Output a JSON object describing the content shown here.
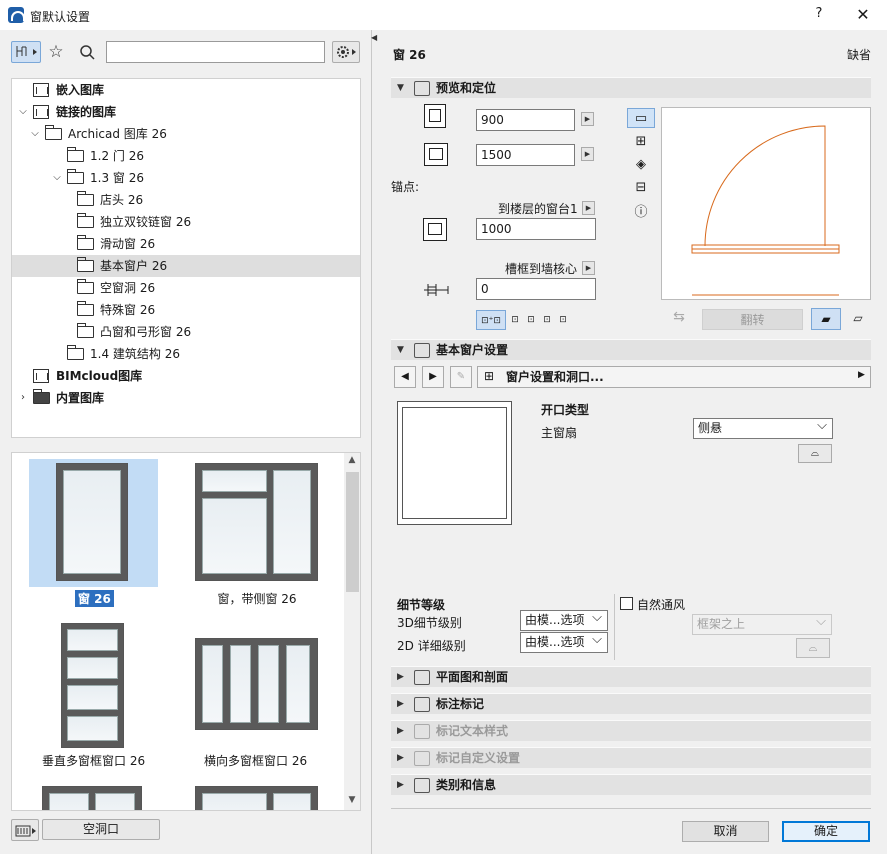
{
  "window": {
    "title": "窗默认设置",
    "help": "?",
    "close": "✕"
  },
  "left": {
    "search_value": "",
    "tree": [
      {
        "label": "嵌入图库",
        "bold": true,
        "indent": 0,
        "chevron": "",
        "icon": "library"
      },
      {
        "label": "链接的图库",
        "bold": true,
        "indent": 0,
        "chevron": "⌵",
        "icon": "library"
      },
      {
        "label": "Archicad 图库 26",
        "bold": false,
        "indent": 1,
        "chevron": "⌵",
        "icon": "folder"
      },
      {
        "label": "1.2 门 26",
        "bold": false,
        "indent": 2,
        "chevron": "",
        "icon": "folder"
      },
      {
        "label": "1.3 窗 26",
        "bold": false,
        "indent": 2,
        "chevron": "⌵",
        "icon": "folder"
      },
      {
        "label": "店头 26",
        "bold": false,
        "indent": 3,
        "chevron": "",
        "icon": "folder"
      },
      {
        "label": "独立双铰链窗 26",
        "bold": false,
        "indent": 3,
        "chevron": "",
        "icon": "folder"
      },
      {
        "label": "滑动窗 26",
        "bold": false,
        "indent": 3,
        "chevron": "",
        "icon": "folder"
      },
      {
        "label": "基本窗户 26",
        "bold": false,
        "indent": 3,
        "chevron": "",
        "icon": "folder",
        "selected": true
      },
      {
        "label": "空窗洞 26",
        "bold": false,
        "indent": 3,
        "chevron": "",
        "icon": "folder"
      },
      {
        "label": "特殊窗 26",
        "bold": false,
        "indent": 3,
        "chevron": "",
        "icon": "folder"
      },
      {
        "label": "凸窗和弓形窗 26",
        "bold": false,
        "indent": 3,
        "chevron": "",
        "icon": "folder"
      },
      {
        "label": "1.4 建筑结构 26",
        "bold": false,
        "indent": 2,
        "chevron": "",
        "icon": "folder"
      },
      {
        "label": "BIMcloud图库",
        "bold": true,
        "indent": 0,
        "chevron": "",
        "icon": "library"
      },
      {
        "label": "内置图库",
        "bold": true,
        "indent": 0,
        "chevron": "›",
        "icon": "folder-dark"
      }
    ],
    "thumbnails": [
      {
        "label": "窗 26",
        "selected": true
      },
      {
        "label": "窗，带侧窗 26",
        "selected": false
      },
      {
        "label": "垂直多窗框窗口 26",
        "selected": false
      },
      {
        "label": "横向多窗框窗口 26",
        "selected": false
      }
    ],
    "empty_hole_button": "空洞口"
  },
  "right": {
    "object_title": "窗 26",
    "default_label": "缺省",
    "sections": {
      "preview": "预览和定位",
      "basic": "基本窗户设置",
      "plan": "平面图和剖面",
      "marker": "标注标记",
      "marker_text": "标记文本样式",
      "marker_custom": "标记自定义设置",
      "category": "类别和信息"
    },
    "width_value": "900",
    "height_value": "1500",
    "anchor_label": "锚点:",
    "sill_label": "到楼层的窗台1",
    "sill_value": "1000",
    "reveal_label": "槽框到墙核心",
    "reveal_value": "0",
    "flip_button": "翻转",
    "nav_select": "窗户设置和洞口...",
    "opening_type_label": "开口类型",
    "main_sash_label": "主窗扇",
    "main_sash_value": "侧悬",
    "detail_level_label": "细节等级",
    "detail_3d_label": "3D细节级别",
    "detail_3d_value": "由模...选项",
    "detail_2d_label": "2D 详细级别",
    "detail_2d_value": "由模...选项",
    "natural_vent_label": "自然通风",
    "natural_vent_value": "框架之上",
    "cancel_button": "取消",
    "ok_button": "确定"
  },
  "colors": {
    "accent": "#0078d7",
    "selection": "#c2dcf5",
    "door_swing": "#d86a1c"
  }
}
